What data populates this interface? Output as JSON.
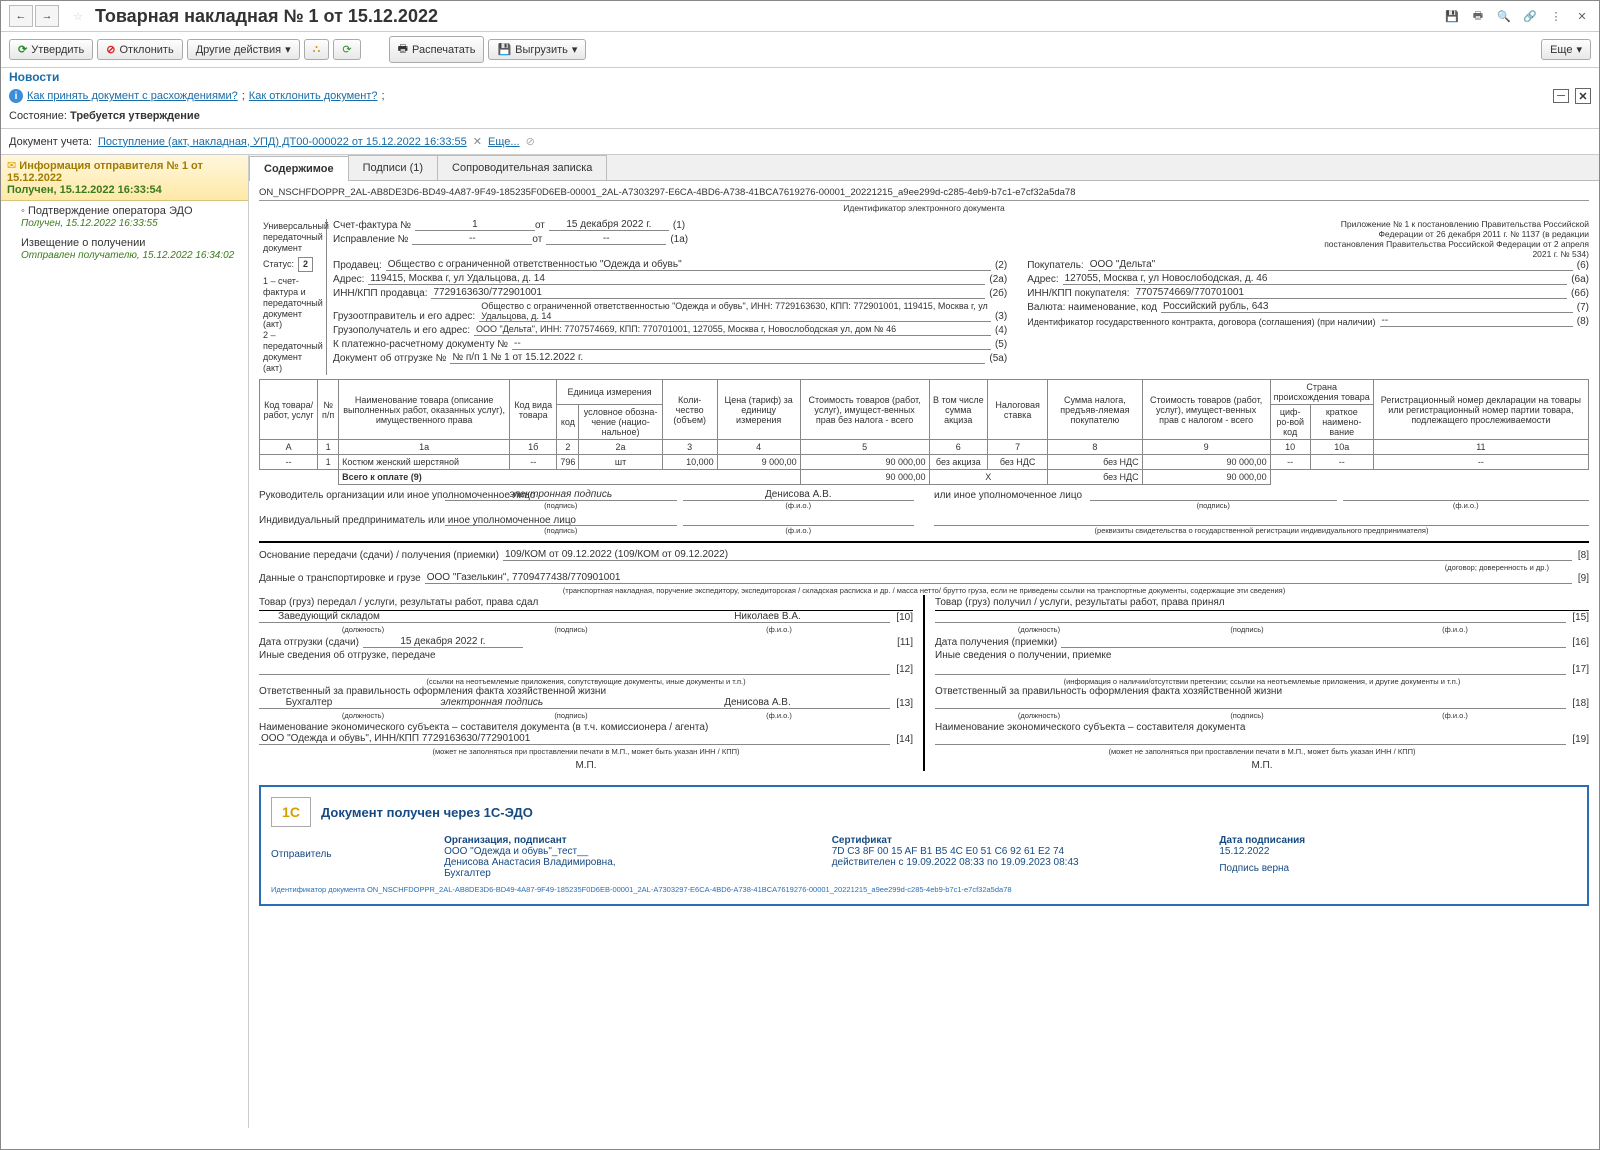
{
  "title": "Товарная накладная № 1 от 15.12.2022",
  "toolbar": {
    "approve": "Утвердить",
    "reject": "Отклонить",
    "other": "Другие действия",
    "print": "Распечатать",
    "export": "Выгрузить",
    "more": "Еще"
  },
  "news": "Новости",
  "info_links": {
    "l1": "Как принять документ с расхождениями?",
    "l2": "Как отклонить документ?"
  },
  "state_lbl": "Состояние:",
  "state_val": "Требуется утверждение",
  "doc_lbl": "Документ учета:",
  "doc_link": "Поступление (акт, накладная, УПД) ДТ00-000022 от 15.12.2022 16:33:55",
  "doc_more": "Еще...",
  "side": {
    "header1": "Информация отправителя № 1 от 15.12.2022",
    "header2": "Получен, 15.12.2022 16:33:54",
    "i1": "Подтверждение оператора ЭДО",
    "i1s": "Получен, 15.12.2022 16:33:55",
    "i2": "Извещение о получении",
    "i2s": "Отправлен получателю, 15.12.2022 16:34:02"
  },
  "tabs": {
    "t1": "Содержимое",
    "t2": "Подписи (1)",
    "t3": "Сопроводительная записка"
  },
  "doc_id": "ON_NSCHFDOPPR_2AL-AB8DE3D6-BD49-4A87-9F49-185235F0D6EB-00001_2AL-A7303297-E6CA-4BD6-A738-41BCA7619276-00001_20221215_a9ee299d-c285-4eb9-b7c1-e7cf32a5da78",
  "doc_id_sub": "Идентификатор электронного документа",
  "left": {
    "l1": "Универсальный передаточный документ",
    "l2": "Статус:",
    "status": "2",
    "l3": "1 – счет-фактура и передаточный документ (акт)",
    "l4": "2 – передаточный документ (акт)"
  },
  "head": {
    "sf_lbl": "Счет-фактура №",
    "sf_no": "1",
    "sf_ot": "от",
    "sf_date": "15 декабря 2022 г.",
    "sf_c": "(1)",
    "isp_lbl": "Исправление №",
    "isp_no": "--",
    "isp_date": "--",
    "isp_c": "(1а)",
    "note": "Приложение № 1 к постановлению Правительства Российской Федерации от 26 декабря 2011 г. № 1137 (в редакции постановления Правительства Российской Федерации от 2 апреля 2021 г. № 534)",
    "seller_lbl": "Продавец:",
    "seller": "Общество с ограниченной ответственностью \"Одежда и обувь\"",
    "c2": "(2)",
    "addr_lbl": "Адрес:",
    "addr": "119415, Москва г, ул Удальцова, д. 14",
    "c2a": "(2а)",
    "inn_lbl": "ИНН/КПП продавца:",
    "inn": "7729163630/772901001",
    "c2b": "(2б)",
    "cons_lbl": "Грузоотправитель и его адрес:",
    "cons": "Общество с ограниченной ответственностью \"Одежда и обувь\", ИНН: 7729163630, КПП: 772901001, 119415, Москва г, ул Удальцова, д. 14",
    "c3": "(3)",
    "rec_lbl": "Грузополучатель и его адрес:",
    "rec": "ООО \"Дельта\", ИНН: 7707574669, КПП: 770701001, 127055, Москва г, Новослободская ул, дом № 46",
    "c4": "(4)",
    "pay_lbl": "К платежно-расчетному документу №",
    "pay": "--",
    "c5": "(5)",
    "ship_lbl": "Документ об отгрузке №",
    "ship": "№ п/п 1 № 1 от 15.12.2022 г.",
    "c5a": "(5а)",
    "buyer_lbl": "Покупатель:",
    "buyer": "ООО \"Дельта\"",
    "c6": "(6)",
    "baddr_lbl": "Адрес:",
    "baddr": "127055, Москва г, ул Новослободская, д. 46",
    "c6a": "(6а)",
    "binn_lbl": "ИНН/КПП покупателя:",
    "binn": "7707574669/770701001",
    "c6b": "(6б)",
    "cur_lbl": "Валюта: наименование, код",
    "cur": "Российский рубль, 643",
    "c7": "(7)",
    "gos_lbl": "Идентификатор государственного контракта, договора (соглашения) (при наличии)",
    "gos": "--",
    "c8": "(8)"
  },
  "th": {
    "c1": "Код товара/ работ, услуг",
    "c2": "№ п/п",
    "c3": "Наименование товара (описание выполненных работ, оказанных услуг), имущественного права",
    "c4": "Код вида товара",
    "c5": "Единица измерения",
    "c5a": "код",
    "c5b": "условное обозна-чение (нацио-нальное)",
    "c6": "Коли-чество (объем)",
    "c7": "Цена (тариф) за единицу измерения",
    "c8": "Стоимость товаров (работ, услуг), имущест-венных прав без налога - всего",
    "c9": "В том числе сумма акциза",
    "c10": "Налоговая ставка",
    "c11": "Сумма налога, предъяв-ляемая покупателю",
    "c12": "Стоимость товаров (работ, услуг), имущест-венных прав с налогом - всего",
    "c13": "Страна происхождения товара",
    "c13a": "циф-ро-вой код",
    "c13b": "краткое наимено-вание",
    "c14": "Регистрационный номер декларации на товары или регистрационный номер партии товара, подлежащего прослеживаемости"
  },
  "nums": {
    "a": "А",
    "n1": "1",
    "n1a": "1а",
    "n1b": "1б",
    "n2": "2",
    "n2a": "2а",
    "n3": "3",
    "n4": "4",
    "n5": "5",
    "n6": "6",
    "n7": "7",
    "n8": "8",
    "n9": "9",
    "n10": "10",
    "n10a": "10а",
    "n11": "11"
  },
  "row": {
    "a": "--",
    "n": "1",
    "name": "Костюм женский шерстяной",
    "kv": "--",
    "u": "796",
    "un": "шт",
    "qty": "10,000",
    "price": "9 000,00",
    "sum": "90 000,00",
    "akc": "без акциза",
    "stavka": "без НДС",
    "tax": "без НДС",
    "total": "90 000,00",
    "cc": "--",
    "cn": "--",
    "dec": "--"
  },
  "total_row": {
    "lbl": "Всего к оплате (9)",
    "sum": "90 000,00",
    "x": "X",
    "tax": "без НДС",
    "total": "90 000,00"
  },
  "sig": {
    "ruk_lbl": "Руководитель организации или иное уполномоченное лицо",
    "ruk_sig": "электронная подпись",
    "ruk_name": "Денисова А.В.",
    "ip_lbl": "Индивидуальный предприниматель или иное уполномоченное лицо",
    "gb_lbl": "или иное уполномоченное лицо",
    "p": "(подпись)",
    "f": "(ф.и.о.)",
    "rek": "(реквизиты свидетельства о государственной регистрации индивидуального предпринимателя)"
  },
  "basis": {
    "lbl": "Основание передачи (сдачи) / получения (приемки)",
    "val": "109/КОМ от 09.12.2022 (109/КОМ от 09.12.2022)",
    "sub": "(договор; доверенность и др.)",
    "c": "[8]"
  },
  "trans": {
    "lbl": "Данные о транспортировке и грузе",
    "val": "ООО \"Газелькин\", 7709477438/770901001",
    "sub": "(транспортная накладная, поручение экспедитору, экспедиторская / складская расписка и др. / масса нетто/ брутто груза, если не приведены ссылки на транспортные документы, содержащие эти сведения)",
    "c": "[9]"
  },
  "bottom": {
    "l_title": "Товар (груз) передал / услуги, результаты работ, права сдал",
    "r_title": "Товар (груз) получил / услуги, результаты работ, права принял",
    "l_pos": "Заведующий складом",
    "l_name": "Николаев В.А.",
    "c10": "[10]",
    "pos_sub": "(должность)",
    "sig_sub": "(подпись)",
    "fio_sub": "(ф.и.о.)",
    "date_l": "Дата отгрузки (сдачи)",
    "date_v": "15 декабря 2022 г.",
    "c11": "[11]",
    "other_l": "Иные сведения об отгрузке, передаче",
    "c12": "[12]",
    "other_sub_l": "(ссылки на неотъемлемые приложения, сопутствующие документы, иные документы и т.п.)",
    "resp_l": "Ответственный за правильность оформления факта хозяйственной жизни",
    "buh": "Бухгалтер",
    "buh_sig": "электронная подпись",
    "buh_name": "Денисова А.В.",
    "c13": "[13]",
    "econ_l": "Наименование экономического субъекта – составителя документа (в т.ч. комиссионера / агента)",
    "econ_v": "ООО \"Одежда и обувь\", ИНН/КПП 7729163630/772901001",
    "c14": "[14]",
    "econ_sub": "(может не заполняться при проставлении печати в М.П., может быть указан ИНН / КПП)",
    "mp": "М.П.",
    "r_c15": "[15]",
    "date_r": "Дата получения (приемки)",
    "c16": "[16]",
    "other_r": "Иные сведения о получении, приемке",
    "c17": "[17]",
    "other_sub_r": "(информация о наличии/отсутствии претензии; ссылки на неотъемлемые приложения, и другие документы и т.п.)",
    "resp_r": "Ответственный за правильность оформления факта хозяйственной жизни",
    "c18": "[18]",
    "econ_r": "Наименование экономического субъекта – составителя документа",
    "c19": "[19]"
  },
  "edo": {
    "title": "Документ получен через 1С-ЭДО",
    "send_lbl": "Отправитель",
    "org_lbl": "Организация, подписант",
    "org1": "ООО \"Одежда и обувь\"_тест__",
    "org2": "Денисова Анастасия Владимировна,",
    "org3": "Бухгалтер",
    "cert_lbl": "Сертификат",
    "cert": "7D C3 8F 00 15 AF B1 B5 4C E0 51 C6 92 61 E2 74",
    "cert_v": "действителен с 19.09.2022 08:33 по 19.09.2023 08:43",
    "date_lbl": "Дата подписания",
    "date": "15.12.2022",
    "ok": "Подпись верна",
    "id": "Идентификатор документа ON_NSCHFDOPPR_2AL-AB8DE3D6-BD49-4A87-9F49-185235F0D6EB-00001_2AL-A7303297-E6CA-4BD6-A738-41BCA7619276-00001_20221215_a9ee299d-c285-4eb9-b7c1-e7cf32a5da78"
  }
}
